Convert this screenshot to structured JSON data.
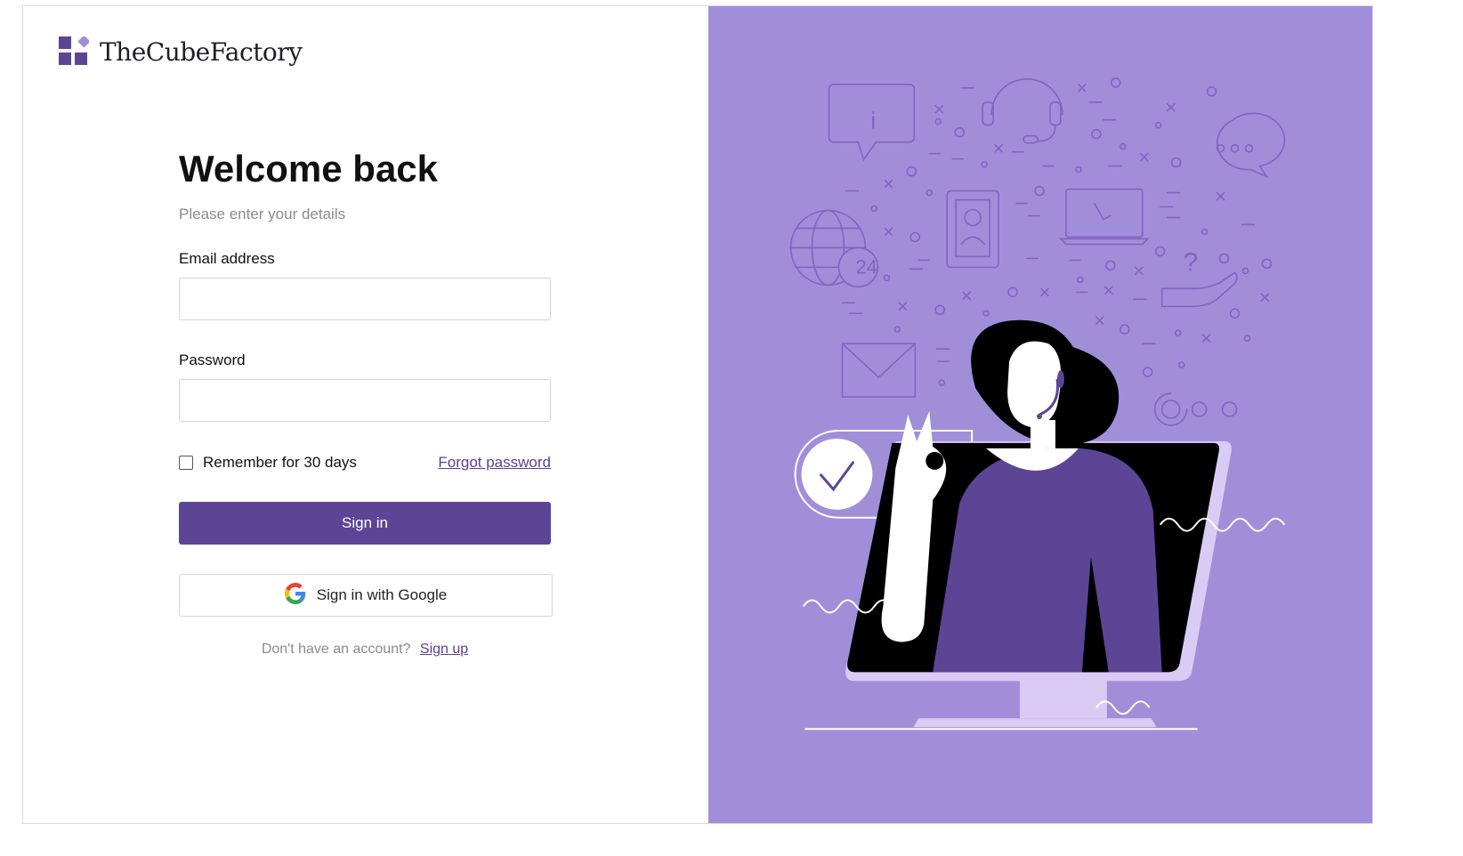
{
  "brand": {
    "name": "TheCubeFactory"
  },
  "form": {
    "title": "Welcome back",
    "subtitle": "Please enter your details",
    "email_label": "Email address",
    "email_value": "",
    "password_label": "Password",
    "password_value": "",
    "remember_label": "Remember for 30 days",
    "remember_checked": false,
    "forgot_label": "Forgot password",
    "signin_label": "Sign in",
    "google_label": "Sign in with Google",
    "no_account_text": "Don't have an account?",
    "signup_label": "Sign up"
  },
  "illustration": {
    "badge_text": "24",
    "info_bubble_text": "i",
    "question_mark": "?"
  },
  "colors": {
    "accent": "#5d4596",
    "panel_bg": "#a18ed9",
    "panel_line": "#7e66c1",
    "link": "#5b3f96"
  },
  "icons": {
    "logo": "cube-logo-icon",
    "google": "google-g-icon",
    "checkbox": "checkbox-unchecked-icon"
  }
}
